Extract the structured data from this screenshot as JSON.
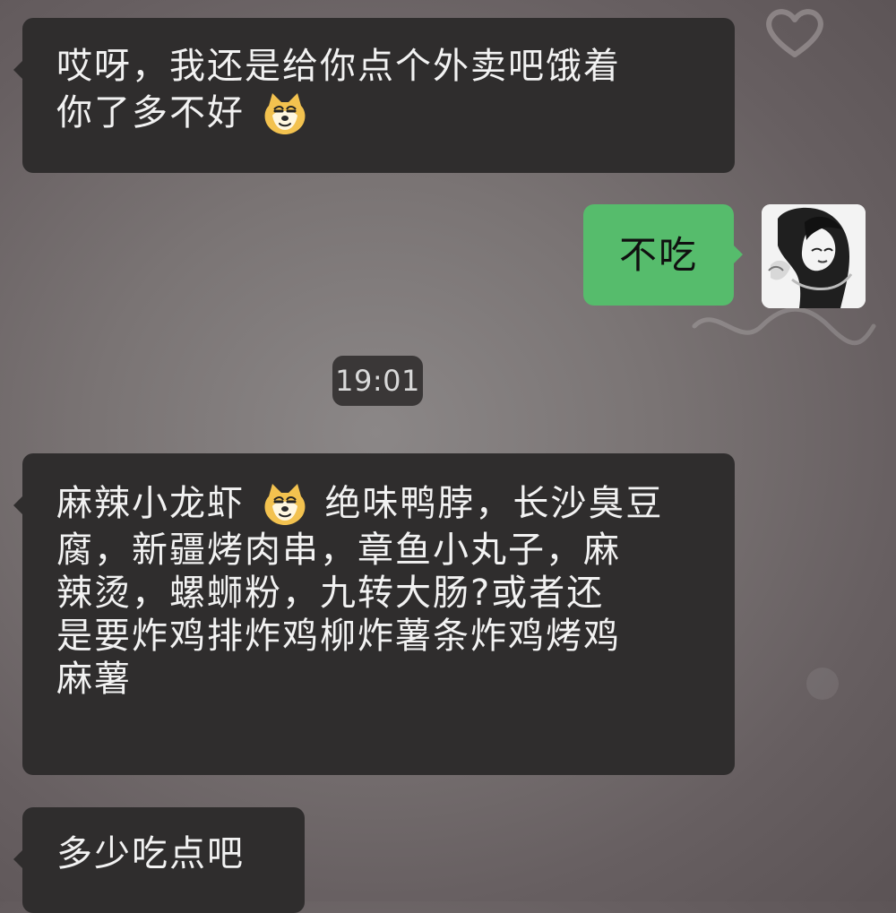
{
  "chat": {
    "messages": [
      {
        "side": "left",
        "line1": "哎呀，我还是给你点个外卖吧饿着",
        "line2": "你了多不好",
        "emoji": "doge-face-emoji"
      },
      {
        "side": "right",
        "text": "不吃"
      },
      {
        "side": "timestamp",
        "text": "19:01"
      },
      {
        "side": "left",
        "line1_part1": "麻辣小龙虾",
        "line1_part2": "绝味鸭脖，长沙臭豆",
        "line2": "腐，新疆烤肉串，章鱼小丸子，麻",
        "line3": "辣烫，螺蛳粉，九转大肠?或者还",
        "line4": "是要炸鸡排炸鸡柳炸薯条炸鸡烤鸡",
        "line5": "麻薯",
        "emoji": "doge-face-emoji"
      },
      {
        "side": "left",
        "text": "多少吃点吧"
      }
    ]
  },
  "colors": {
    "background": "#7a7474",
    "left_bubble": "#2f2d2d",
    "right_bubble": "#56bc6c",
    "timestamp_bubble": "#3a3737"
  }
}
